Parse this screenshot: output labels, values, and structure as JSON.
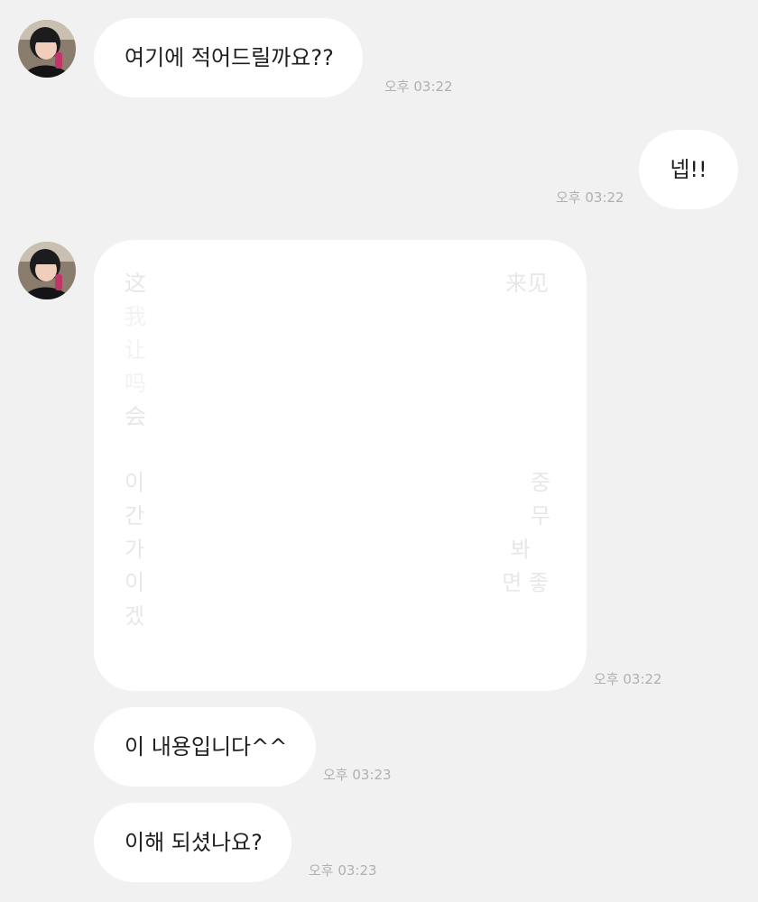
{
  "messages": [
    {
      "text": "여기에 적어드릴까요??",
      "time": "오후 03:22"
    },
    {
      "text": "넵!!",
      "time": "오후 03:22"
    },
    {
      "time": "오후 03:22",
      "fragments": [
        {
          "left": "这",
          "right": "来见"
        },
        {
          "left": "我",
          "right": ""
        },
        {
          "left": "让",
          "right": ""
        },
        {
          "left": "吗",
          "right": ""
        },
        {
          "left": "会",
          "right": ""
        },
        {
          "left": "이",
          "right": "중"
        },
        {
          "left": "간",
          "right": "무"
        },
        {
          "left": "가",
          "right": "봐"
        },
        {
          "left": "이",
          "right": "면 좋"
        },
        {
          "left": "겠",
          "right": ""
        }
      ]
    },
    {
      "text": "이 내용입니다^^",
      "time": "오후 03:23"
    },
    {
      "text": "이해 되셨나요?",
      "time": "오후 03:23"
    }
  ]
}
